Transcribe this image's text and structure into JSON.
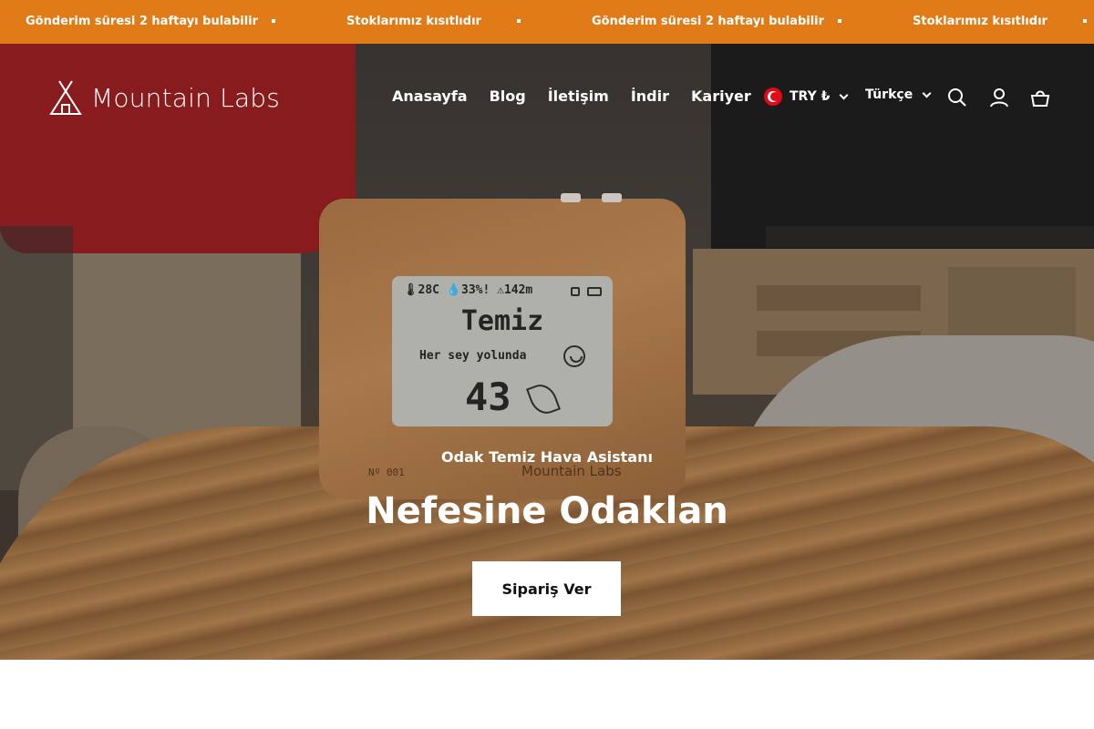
{
  "announcement": {
    "messages": [
      "Gönderim süresi 2 haftayı bulabilir",
      "Stoklarımız kısıtlıdır",
      "Gönderim süresi 2 haftayı bulabilir",
      "Stoklarımız kısıtlıdır"
    ],
    "background": "#e07b17"
  },
  "header": {
    "logo_text": "Mountain Labs",
    "nav": [
      "Anasayfa",
      "Blog",
      "İletişim",
      "İndir",
      "Kariyer"
    ],
    "currency": "TRY ₺",
    "language": "Türkçe",
    "icons": [
      "search-icon",
      "account-icon",
      "cart-icon"
    ]
  },
  "device": {
    "status_line": "🌡28C 💧33%! ⚠142m",
    "state": "Temiz",
    "message": "Her sey yolunda",
    "value": "43",
    "serial": "Nº 001",
    "brand": "Mountain Labs"
  },
  "hero": {
    "subtitle": "Odak Temiz Hava Asistanı",
    "title": "Nefesine Odaklan",
    "cta": "Sipariş Ver"
  }
}
